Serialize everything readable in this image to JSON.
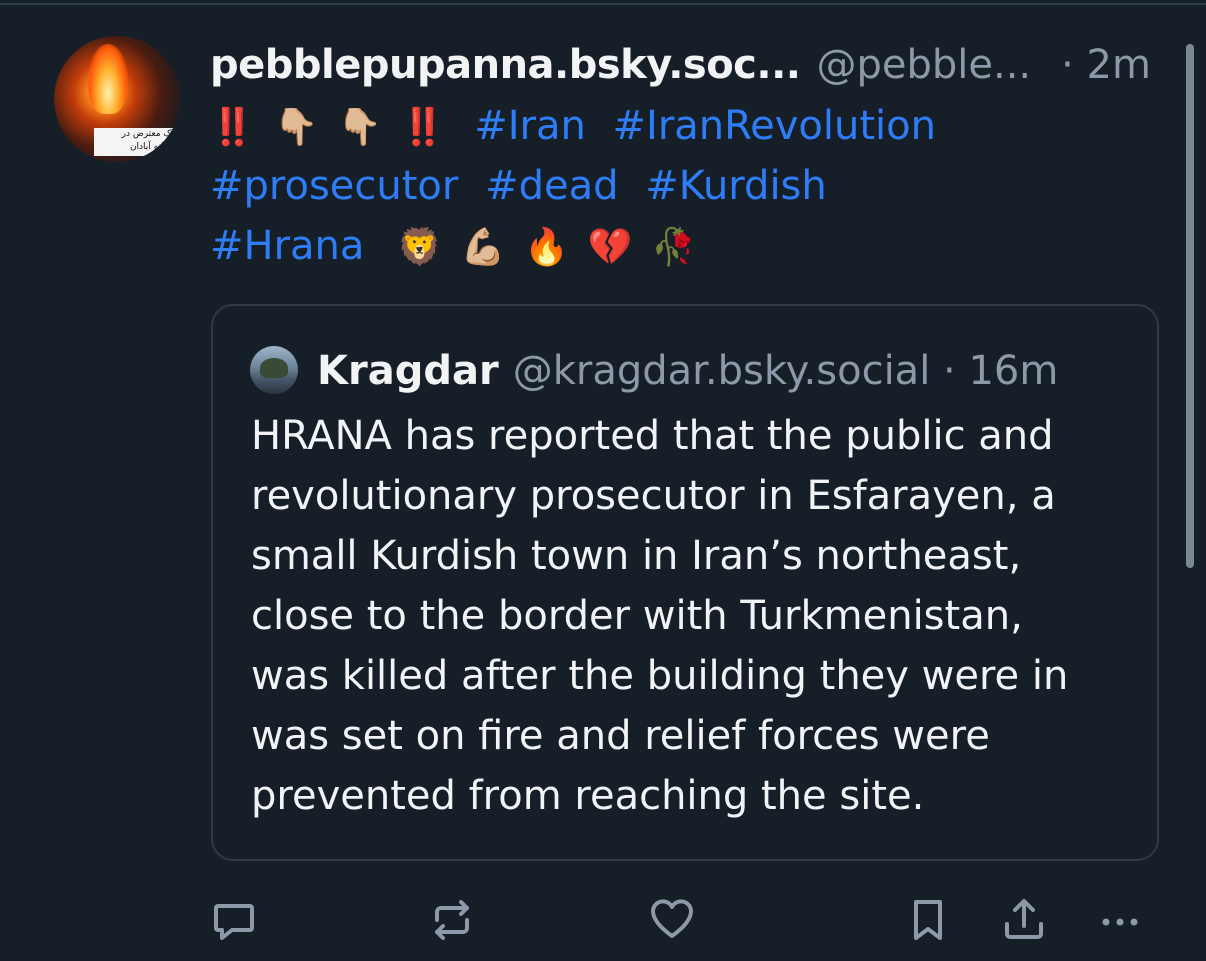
{
  "post": {
    "author_name": "pebblepupanna.bsky.soc...",
    "author_handle": "@pebble...",
    "time": "· 2m",
    "avatar_caption_1": "یک معترض در",
    "avatar_caption_2": "شبانه آبادان",
    "line1": {
      "bang1": "‼️",
      "emoji1": "👇🏼",
      "emoji2": "👇🏼",
      "bang2": "‼️",
      "tags": [
        "#Iran",
        "#IranRevolution"
      ]
    },
    "line2": {
      "tags": [
        "#prosecutor",
        "#dead",
        "#Kurdish"
      ]
    },
    "line3": {
      "tags": [
        "#Hrana"
      ],
      "emojis": [
        "🦁",
        "💪🏼",
        "🔥",
        "💔",
        "🥀"
      ]
    }
  },
  "quote": {
    "author_name": "Kragdar",
    "author_handle": "@kragdar.bsky.social · 16m",
    "body_lines": [
      "HRANA has reported that the public and",
      "revolutionary prosecutor in Esfarayen, a",
      "small Kurdish town in Iran’s northeast,",
      "close to the border with Turkmenistan,",
      "was killed after the building they were in",
      "was set on fire and relief forces were",
      "prevented from reaching the site."
    ]
  },
  "actions": {
    "icons": [
      "reply-icon",
      "repost-icon",
      "like-icon",
      "bookmark-icon",
      "share-icon",
      "more-icon"
    ]
  },
  "colors": {
    "background": "#161e27",
    "hashtag": "#2f7df6",
    "muted": "#8d99a8",
    "text": "#f1f3f5",
    "alert": "#e3152b"
  }
}
